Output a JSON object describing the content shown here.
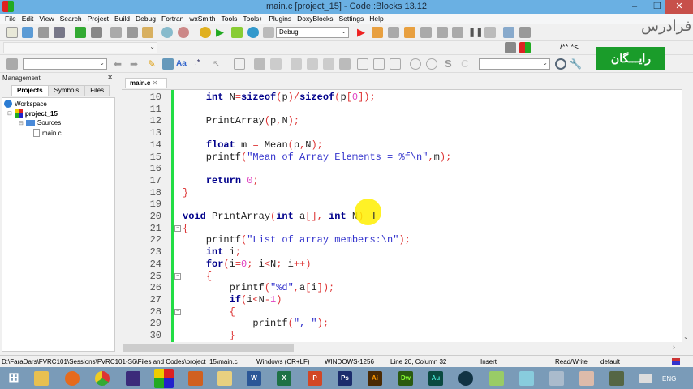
{
  "window": {
    "title": "main.c [project_15] - Code::Blocks 13.12",
    "minimize": "‒",
    "restore": "❐",
    "close": "✕"
  },
  "menu": [
    "File",
    "Edit",
    "View",
    "Search",
    "Project",
    "Build",
    "Debug",
    "Fortran",
    "wxSmith",
    "Tools",
    "Tools+",
    "Plugins",
    "DoxyBlocks",
    "Settings",
    "Help"
  ],
  "toolbar": {
    "build_target": "Debug",
    "doxy_label": "/** *<",
    "regex_label": ".*",
    "aa_label": "Aa"
  },
  "watermark": {
    "brand": "فرادرس",
    "badge": "رایـــگان"
  },
  "management": {
    "title": "Management",
    "close": "✕",
    "tabs": [
      "Projects",
      "Symbols",
      "Files"
    ],
    "tree": {
      "workspace": "Workspace",
      "project": "project_15",
      "folder": "Sources",
      "file": "main.c"
    }
  },
  "editor": {
    "tab": "main.c",
    "tab_close": "✕",
    "lines": [
      {
        "n": "10",
        "c": [
          [
            "id",
            "    "
          ],
          [
            "kw",
            "int"
          ],
          [
            "id",
            " N"
          ],
          [
            "op",
            "="
          ],
          [
            "kw",
            "sizeof"
          ],
          [
            "op",
            "("
          ],
          [
            "id",
            "p"
          ],
          [
            "op",
            ")/"
          ],
          [
            "kw",
            "sizeof"
          ],
          [
            "op",
            "("
          ],
          [
            "id",
            "p"
          ],
          [
            "op",
            "["
          ],
          [
            "nu",
            "0"
          ],
          [
            "op",
            "]);"
          ]
        ]
      },
      {
        "n": "11",
        "c": []
      },
      {
        "n": "12",
        "c": [
          [
            "id",
            "    PrintArray"
          ],
          [
            "op",
            "("
          ],
          [
            "id",
            "p"
          ],
          [
            "op",
            ","
          ],
          [
            "id",
            "N"
          ],
          [
            "op",
            ");"
          ]
        ]
      },
      {
        "n": "13",
        "c": []
      },
      {
        "n": "14",
        "c": [
          [
            "id",
            "    "
          ],
          [
            "kw",
            "float"
          ],
          [
            "id",
            " m "
          ],
          [
            "op",
            "="
          ],
          [
            "id",
            " Mean"
          ],
          [
            "op",
            "("
          ],
          [
            "id",
            "p"
          ],
          [
            "op",
            ","
          ],
          [
            "id",
            "N"
          ],
          [
            "op",
            ");"
          ]
        ]
      },
      {
        "n": "15",
        "c": [
          [
            "id",
            "    printf"
          ],
          [
            "op",
            "("
          ],
          [
            "st",
            "\"Mean of Array Elements = %f\\n\""
          ],
          [
            "op",
            ","
          ],
          [
            "id",
            "m"
          ],
          [
            "op",
            ");"
          ]
        ]
      },
      {
        "n": "16",
        "c": []
      },
      {
        "n": "17",
        "c": [
          [
            "id",
            "    "
          ],
          [
            "kw",
            "return"
          ],
          [
            "id",
            " "
          ],
          [
            "nu",
            "0"
          ],
          [
            "op",
            ";"
          ]
        ]
      },
      {
        "n": "18",
        "c": [
          [
            "op",
            "}"
          ]
        ]
      },
      {
        "n": "19",
        "c": []
      },
      {
        "n": "20",
        "c": [
          [
            "kw",
            "void"
          ],
          [
            "id",
            " PrintArray"
          ],
          [
            "op",
            "("
          ],
          [
            "kw",
            "int"
          ],
          [
            "id",
            " a"
          ],
          [
            "op",
            "[],"
          ],
          [
            "id",
            " "
          ],
          [
            "kw",
            "int"
          ],
          [
            "id",
            " N"
          ],
          [
            "op",
            ")"
          ]
        ]
      },
      {
        "n": "21",
        "c": [
          [
            "op",
            "{"
          ]
        ]
      },
      {
        "n": "22",
        "c": [
          [
            "id",
            "    printf"
          ],
          [
            "op",
            "("
          ],
          [
            "st",
            "\"List of array members:\\n\""
          ],
          [
            "op",
            ");"
          ]
        ]
      },
      {
        "n": "23",
        "c": [
          [
            "id",
            "    "
          ],
          [
            "kw",
            "int"
          ],
          [
            "id",
            " i"
          ],
          [
            "op",
            ";"
          ]
        ]
      },
      {
        "n": "24",
        "c": [
          [
            "id",
            "    "
          ],
          [
            "kw",
            "for"
          ],
          [
            "op",
            "("
          ],
          [
            "id",
            "i"
          ],
          [
            "op",
            "="
          ],
          [
            "nu",
            "0"
          ],
          [
            "op",
            ";"
          ],
          [
            "id",
            " i"
          ],
          [
            "op",
            "<"
          ],
          [
            "id",
            "N"
          ],
          [
            "op",
            ";"
          ],
          [
            "id",
            " i"
          ],
          [
            "op",
            "++)"
          ]
        ]
      },
      {
        "n": "25",
        "c": [
          [
            "id",
            "    "
          ],
          [
            "op",
            "{"
          ]
        ]
      },
      {
        "n": "26",
        "c": [
          [
            "id",
            "        printf"
          ],
          [
            "op",
            "("
          ],
          [
            "st",
            "\"%d\""
          ],
          [
            "op",
            ","
          ],
          [
            "id",
            "a"
          ],
          [
            "op",
            "["
          ],
          [
            "id",
            "i"
          ],
          [
            "op",
            "]);"
          ]
        ]
      },
      {
        "n": "27",
        "c": [
          [
            "id",
            "        "
          ],
          [
            "kw",
            "if"
          ],
          [
            "op",
            "("
          ],
          [
            "id",
            "i"
          ],
          [
            "op",
            "<"
          ],
          [
            "id",
            "N"
          ],
          [
            "op",
            "-"
          ],
          [
            "nu",
            "1"
          ],
          [
            "op",
            ")"
          ]
        ]
      },
      {
        "n": "28",
        "c": [
          [
            "id",
            "        "
          ],
          [
            "op",
            "{"
          ]
        ]
      },
      {
        "n": "29",
        "c": [
          [
            "id",
            "            printf"
          ],
          [
            "op",
            "("
          ],
          [
            "st",
            "\", \""
          ],
          [
            "op",
            ");"
          ]
        ]
      },
      {
        "n": "30",
        "c": [
          [
            "id",
            "        "
          ],
          [
            "op",
            "}"
          ]
        ]
      }
    ]
  },
  "status": {
    "path": "D:\\FaraDars\\FVRC101\\Sessions\\FVRC101-S6\\Files and Codes\\project_15\\main.c",
    "eol": "Windows (CR+LF)",
    "encoding": "WINDOWS-1256",
    "position": "Line 20, Column 32",
    "mode": "Insert",
    "access": "Read/Write",
    "lang": "default"
  },
  "taskbar": {
    "apps": [
      "Word",
      "Excel",
      "PowerPoint",
      "Photoshop",
      "Illustrator",
      "Dreamweaver",
      "Audition"
    ],
    "labels": [
      "W",
      "X",
      "P",
      "Ps",
      "Ai",
      "Dw",
      "Au"
    ],
    "lang": "ENG"
  }
}
